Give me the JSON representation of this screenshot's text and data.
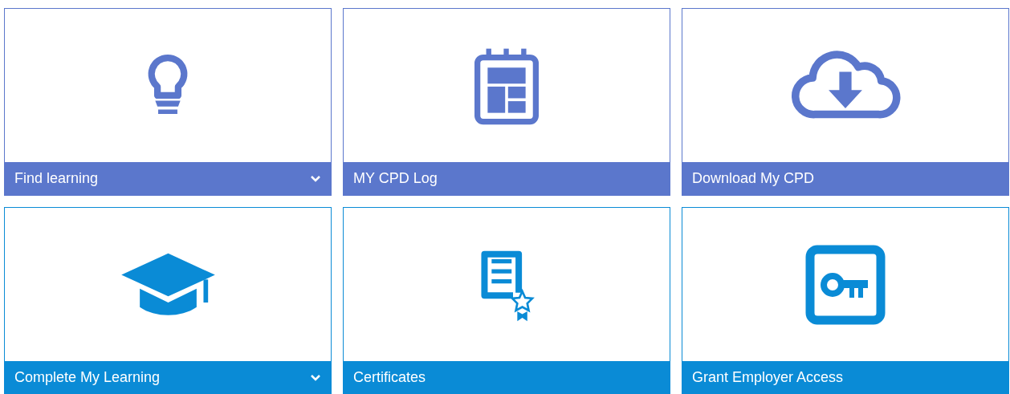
{
  "tiles": [
    {
      "label": "Find learning",
      "kind": "bulb",
      "color": "#5b77cc",
      "expandable": true
    },
    {
      "label": "MY CPD Log",
      "kind": "calendar",
      "color": "#5b77cc",
      "expandable": false
    },
    {
      "label": "Download My CPD",
      "kind": "download",
      "color": "#5b77cc",
      "expandable": false
    },
    {
      "label": "Complete My Learning",
      "kind": "cap",
      "color": "#0a8bd6",
      "expandable": true
    },
    {
      "label": "Certificates",
      "kind": "certificate",
      "color": "#0a8bd6",
      "expandable": false
    },
    {
      "label": "Grant Employer Access",
      "kind": "key",
      "color": "#0a8bd6",
      "expandable": false
    }
  ]
}
